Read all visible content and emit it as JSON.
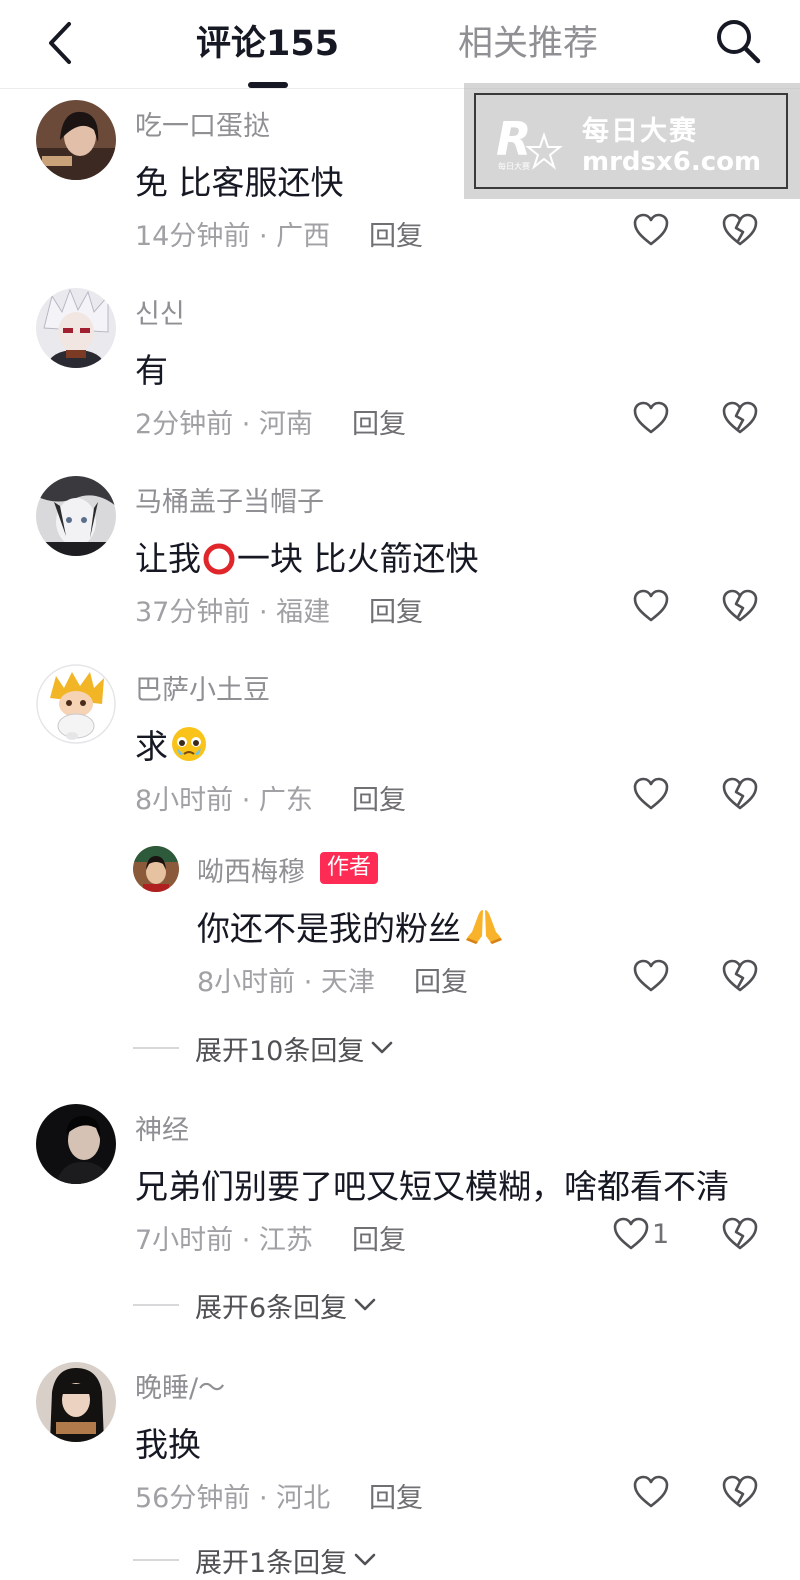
{
  "header": {
    "tabs": [
      {
        "label": "评论155",
        "active": true
      },
      {
        "label": "相关推荐",
        "active": false
      }
    ],
    "icons": {
      "back": "chevron-left-icon",
      "search": "search-icon"
    }
  },
  "comments": [
    {
      "username": "吃一口蛋挞",
      "content": "免 比客服还快",
      "meta": "14分钟前 · 广西",
      "reply_label": "回复"
    },
    {
      "username": "신신",
      "content": "有",
      "meta": "2分钟前 · 河南",
      "reply_label": "回复"
    },
    {
      "username": "马桶盖子当帽子",
      "content_before": "让我",
      "content_after": "一块 比火箭还快",
      "meta": "37分钟前 · 福建",
      "reply_label": "回复"
    },
    {
      "username": "巴萨小土豆",
      "content": "求",
      "meta": "8小时前 · 广东",
      "reply_label": "回复",
      "reply": {
        "username": "呦西梅穆",
        "badge": "作者",
        "content": "你还不是我的粉丝",
        "meta": "8小时前 · 天津",
        "reply_label": "回复"
      },
      "expand_label": "展开10条回复"
    },
    {
      "username": "神经",
      "content": "兄弟们别要了吧又短又模糊，啥都看不清",
      "meta": "7小时前 · 江苏",
      "reply_label": "回复",
      "like_count": "1",
      "expand_label": "展开6条回复"
    },
    {
      "username": "晚睡/～",
      "content": "我换",
      "meta": "56分钟前 · 河北",
      "reply_label": "回复",
      "expand_label": "展开1条回复"
    }
  ],
  "watermark": {
    "name": "每日大赛",
    "url": "mrdsx6.com",
    "logo_letter": "R",
    "logo_sub": "每日大赛"
  },
  "colors": {
    "text_primary": "#161823",
    "text_secondary": "#8f8f94",
    "badge_red": "#fe2c55"
  }
}
